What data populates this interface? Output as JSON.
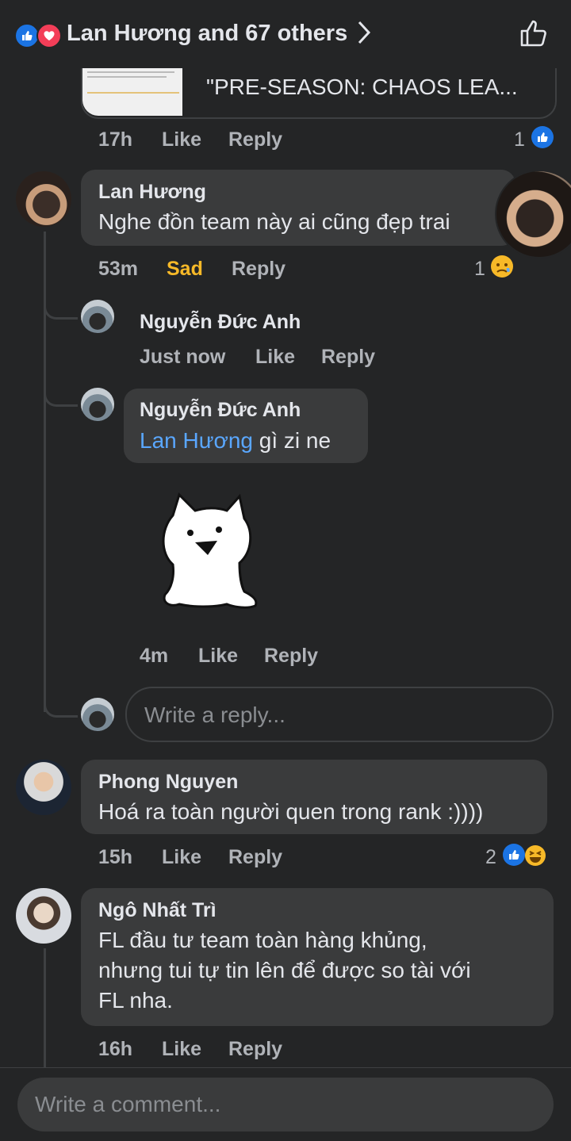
{
  "header": {
    "reactions_summary": "Lan Hương and 67 others",
    "chevron": ">"
  },
  "link_preview": {
    "title_partial": "\"PRE-SEASON: CHAOS LEA..."
  },
  "comment0": {
    "time": "17h",
    "like_label": "Like",
    "reply_label": "Reply",
    "reaction_count": "1"
  },
  "comment1": {
    "author": "Lan Hương",
    "text": "Nghe đồn team này ai cũng đẹp trai",
    "time": "53m",
    "reaction_label": "Sad",
    "reply_label": "Reply",
    "reaction_count": "1"
  },
  "reply1": {
    "author": "Nguyễn Đức Anh",
    "time": "Just now",
    "like_label": "Like",
    "reply_label": "Reply"
  },
  "reply2": {
    "author": "Nguyễn Đức Anh",
    "mention": "Lan Hương",
    "text": "gì zi ne",
    "time": "4m",
    "like_label": "Like",
    "reply_label": "Reply"
  },
  "reply_input": {
    "placeholder": "Write a reply..."
  },
  "comment2": {
    "author": "Phong Nguyen",
    "text": "Hoá ra toàn người quen trong rank :))))",
    "time": "15h",
    "like_label": "Like",
    "reply_label": "Reply",
    "reaction_count": "2"
  },
  "comment3": {
    "author": "Ngô Nhất Trì",
    "text_line1": "FL đầu tư team toàn hàng khủng,",
    "text_line2": "nhưng tui tự tin lên để được so tài với",
    "text_line3": "FL nha.",
    "time": "16h",
    "like_label": "Like",
    "reply_label": "Reply"
  },
  "comment_input": {
    "placeholder": "Write a comment..."
  },
  "colors": {
    "background": "#242526",
    "bubble": "#3a3b3c",
    "accent_blue": "#1b74e4",
    "sad_yellow": "#f7b928",
    "mention": "#5aa7ff"
  }
}
